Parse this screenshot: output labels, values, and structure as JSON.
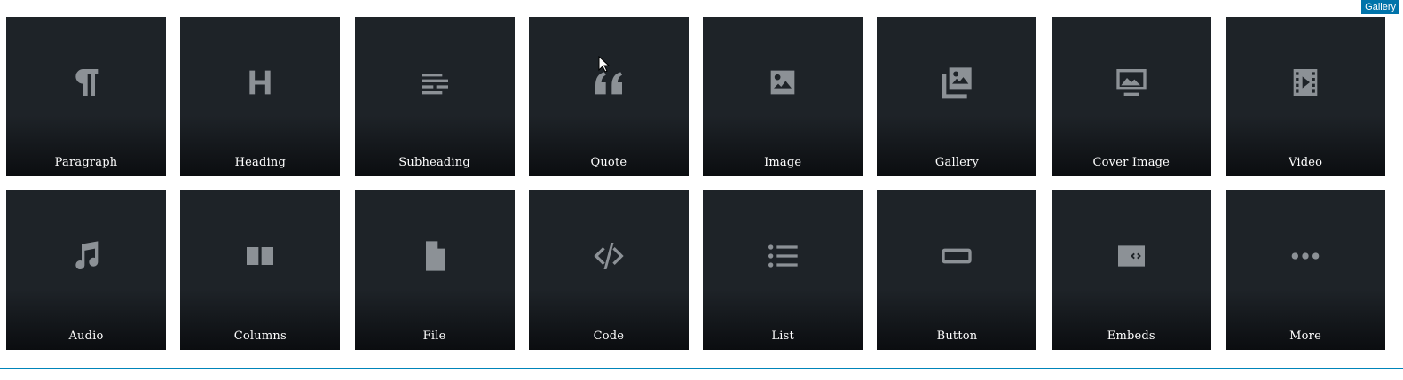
{
  "tooltip": "Gallery",
  "blocks": [
    {
      "label": "Paragraph",
      "icon": "paragraph-icon"
    },
    {
      "label": "Heading",
      "icon": "heading-icon"
    },
    {
      "label": "Subheading",
      "icon": "subheading-icon"
    },
    {
      "label": "Quote",
      "icon": "quote-icon"
    },
    {
      "label": "Image",
      "icon": "image-icon"
    },
    {
      "label": "Gallery",
      "icon": "gallery-icon"
    },
    {
      "label": "Cover Image",
      "icon": "cover-image-icon"
    },
    {
      "label": "Video",
      "icon": "video-icon"
    },
    {
      "label": "Audio",
      "icon": "audio-icon"
    },
    {
      "label": "Columns",
      "icon": "columns-icon"
    },
    {
      "label": "File",
      "icon": "file-icon"
    },
    {
      "label": "Code",
      "icon": "code-icon"
    },
    {
      "label": "List",
      "icon": "list-icon"
    },
    {
      "label": "Button",
      "icon": "button-icon"
    },
    {
      "label": "Embeds",
      "icon": "embeds-icon"
    },
    {
      "label": "More",
      "icon": "more-icon"
    }
  ],
  "colors": {
    "tile": "#1e2328",
    "icon": "#8c9196",
    "accent": "#0073aa"
  }
}
